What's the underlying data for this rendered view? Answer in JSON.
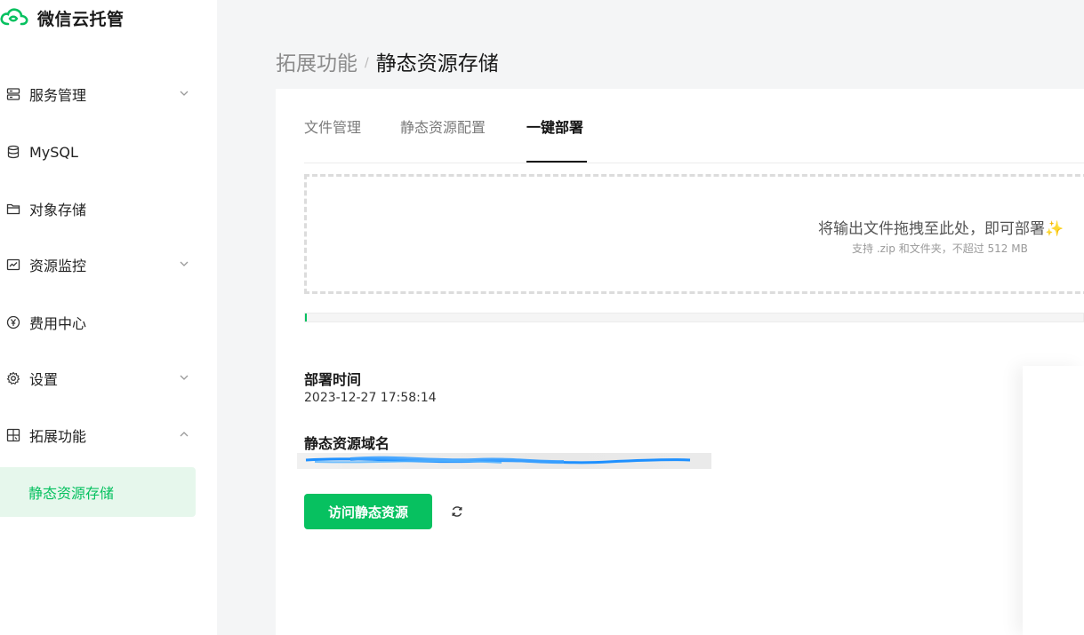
{
  "app": {
    "name": "微信云托管"
  },
  "sidebar": {
    "items": [
      {
        "label": "服务管理",
        "icon": "server-icon",
        "expandable": true,
        "expanded": false
      },
      {
        "label": "MySQL",
        "icon": "database-icon",
        "expandable": false
      },
      {
        "label": "对象存储",
        "icon": "folder-icon",
        "expandable": false
      },
      {
        "label": "资源监控",
        "icon": "monitor-chart-icon",
        "expandable": true,
        "expanded": false
      },
      {
        "label": "费用中心",
        "icon": "yen-icon",
        "expandable": false
      },
      {
        "label": "设置",
        "icon": "gear-icon",
        "expandable": true,
        "expanded": false
      },
      {
        "label": "拓展功能",
        "icon": "extension-icon",
        "expandable": true,
        "expanded": true
      }
    ],
    "sub_items": [
      {
        "label": "静态资源存储",
        "active": true
      }
    ]
  },
  "breadcrumb": {
    "parent": "拓展功能",
    "separator": "/",
    "current": "静态资源存储"
  },
  "tabs": [
    {
      "label": "文件管理",
      "active": false
    },
    {
      "label": "静态资源配置",
      "active": false
    },
    {
      "label": "一键部署",
      "active": true
    }
  ],
  "dropzone": {
    "title": "将输出文件拖拽至此处，即可部署✨",
    "subtitle": "支持 .zip 和文件夹，不超过 512 MB"
  },
  "progress": {
    "value": 0.002
  },
  "deploy": {
    "time_label": "部署时间",
    "time_value": "2023-12-27 17:58:14",
    "domain_label": "静态资源域名"
  },
  "actions": {
    "visit_button": "访问静态资源",
    "refresh_icon": "refresh-icon"
  },
  "colors": {
    "brand": "#07c160",
    "active_bg": "#e6f7ec"
  }
}
